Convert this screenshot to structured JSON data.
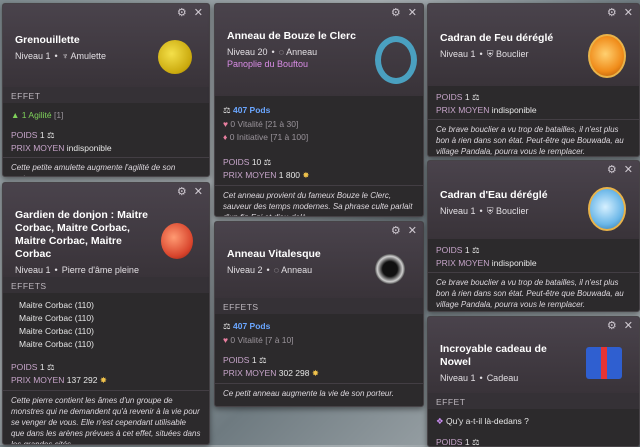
{
  "controls": {
    "gear": "⚙",
    "close": "✕"
  },
  "c1": {
    "title": "Grenouillette",
    "level": "Niveau 1",
    "type": "Amulette",
    "effects_header": "EFFET",
    "effect": "1 Agilité",
    "effect_range": "[1]",
    "weight_label": "POIDS",
    "weight": "1",
    "price_label": "PRIX MOYEN",
    "price": "indisponible",
    "desc": "Cette petite amulette augmente l'agilité de son porteur."
  },
  "c2": {
    "title": "Anneau de Bouze le Clerc",
    "level": "Niveau 20",
    "type": "Anneau",
    "set": "Panoplie du Bouftou",
    "effects_header": "EFFETS",
    "pods": "407 Pods",
    "e1": "0 Vitalité",
    "e1r": "[21 à 30]",
    "e2": "0 Initiative",
    "e2r": "[71 à 100]",
    "weight_label": "POIDS",
    "weight": "10",
    "price_label": "PRIX MOYEN",
    "price": "1 800",
    "desc": "Cet anneau provient du fameux Bouze le Clerc, sauveur des temps modernes. Sa phrase culte parlait d'un fin Eni et d'au-delà."
  },
  "c3": {
    "title": "Cadran de Feu déréglé",
    "level": "Niveau 1",
    "type": "Bouclier",
    "weight_label": "POIDS",
    "weight": "1",
    "price_label": "PRIX MOYEN",
    "price": "indisponible",
    "desc": "Ce brave bouclier a vu trop de batailles, il n'est plus bon à rien dans son état. Peut-être que Bouwada, au village Pandala, pourra vous le remplacer."
  },
  "c4": {
    "title": "Gardien de donjon : Maitre Corbac, Maitre Corbac, Maitre Corbac, Maitre Corbac",
    "level": "Niveau 1",
    "type": "Pierre d'âme pleine",
    "effects_header": "EFFETS",
    "mobs": [
      "Maitre Corbac (110)",
      "Maitre Corbac (110)",
      "Maitre Corbac (110)",
      "Maitre Corbac (110)"
    ],
    "weight_label": "POIDS",
    "weight": "1",
    "price_label": "PRIX MOYEN",
    "price": "137 292",
    "desc": "Cette pierre contient les âmes d'un groupe de monstres qui ne demandent qu'à revenir à la vie pour se venger de vous. Elle n'est cependant utilisable que dans les arènes prévues à cet effet, situées dans les grandes cités."
  },
  "c5": {
    "title": "Anneau Vitalesque",
    "level": "Niveau 2",
    "type": "Anneau",
    "effects_header": "EFFETS",
    "pods": "407 Pods",
    "e1": "0 Vitalité",
    "e1r": "[7 à 10]",
    "weight_label": "POIDS",
    "weight": "1",
    "price_label": "PRIX MOYEN",
    "price": "302 298",
    "desc": "Ce petit anneau augmente la vie de son porteur."
  },
  "c6": {
    "title": "Cadran d'Eau déréglé",
    "level": "Niveau 1",
    "type": "Bouclier",
    "weight_label": "POIDS",
    "weight": "1",
    "price_label": "PRIX MOYEN",
    "price": "indisponible",
    "desc": "Ce brave bouclier a vu trop de batailles, il n'est plus bon à rien dans son état. Peut-être que Bouwada, au village Pandala, pourra vous le remplacer."
  },
  "c7": {
    "title": "Incroyable cadeau de Nowel",
    "level": "Niveau 1",
    "type": "Cadeau",
    "effects_header": "EFFET",
    "effect": "Qu'y a-t-il là-dedans ?",
    "weight_label": "POIDS",
    "weight": "1"
  }
}
